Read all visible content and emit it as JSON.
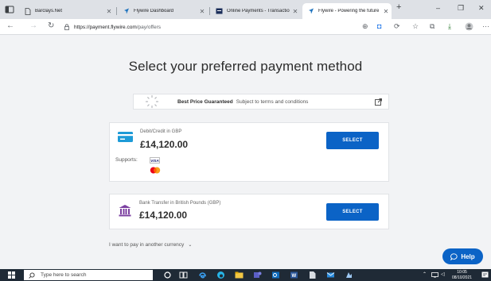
{
  "browser": {
    "tabs": [
      {
        "title": "Barclays.Net",
        "favicon": "document-icon"
      },
      {
        "title": "Flywire Dashboard",
        "favicon": "flywire-icon"
      },
      {
        "title": "Online Payments - Transaction d",
        "favicon": "payments-icon"
      },
      {
        "title": "Flywire - Powering the future of",
        "favicon": "flywire-icon",
        "active": true
      }
    ],
    "new_tab": "+",
    "url_host": "https://payment.flywire.com",
    "url_path": "/pay/offers"
  },
  "page": {
    "heading": "Select your preferred payment method",
    "guarantee": {
      "bold": "Best Price Guaranteed",
      "text": "Subject to terms and conditions"
    },
    "methods": [
      {
        "label": "Debit/Credit in GBP",
        "amount": "£14,120.00",
        "button": "SELECT",
        "supports_label": "Supports:",
        "card_brands": [
          "VISA",
          "Mastercard"
        ]
      },
      {
        "label": "Bank Transfer in British Pounds (GBP)",
        "amount": "£14,120.00",
        "button": "SELECT"
      }
    ],
    "other_currency": "I want to pay in another currency",
    "help": "Help"
  },
  "taskbar": {
    "search_placeholder": "Type here to search",
    "time": "10:05",
    "date": "08/10/2021"
  },
  "colors": {
    "accent": "#0b63c6",
    "card_icon": "#1e9bd7",
    "bank_icon": "#7b3fa0"
  }
}
